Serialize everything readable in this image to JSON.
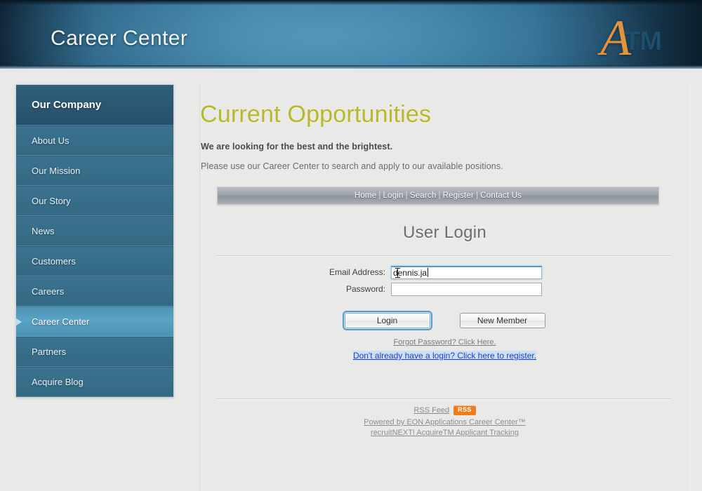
{
  "header": {
    "site_title": "Career Center",
    "logo_a": "A",
    "logo_tm": "TM"
  },
  "sidebar": {
    "heading": "Our Company",
    "items": [
      {
        "label": "About Us",
        "active": false
      },
      {
        "label": "Our Mission",
        "active": false
      },
      {
        "label": "Our Story",
        "active": false
      },
      {
        "label": "News",
        "active": false
      },
      {
        "label": "Customers",
        "active": false
      },
      {
        "label": "Careers",
        "active": false
      },
      {
        "label": "Career Center",
        "active": true
      },
      {
        "label": "Partners",
        "active": false
      },
      {
        "label": "Acquire Blog",
        "active": false
      }
    ]
  },
  "main": {
    "page_title": "Current Opportunities",
    "lead_1": "We are looking for the best and the brightest.",
    "lead_2": "Please use our Career Center to search and apply to our available positions.",
    "nav": {
      "home": "Home",
      "login": "Login",
      "search": "Search",
      "register": "Register",
      "contact": "Contact Us",
      "separator": "|"
    },
    "login": {
      "title": "User Login",
      "email_label": "Email Address:",
      "email_value": "dennis.ja",
      "email_placeholder": "",
      "password_label": "Password:",
      "password_value": "",
      "password_placeholder": "",
      "login_button": "Login",
      "new_member_button": "New Member",
      "forgot_link": "Forgot Password? Click Here.",
      "register_link": "Don't already have a login? Click here to register."
    },
    "footer": {
      "rss_text": "RSS Feed",
      "rss_badge": "RSS",
      "powered_by": "Powered by EON Applications Career Center™",
      "products": "recruitNEXT! AcquireTM Applicant Tracking"
    }
  },
  "colors": {
    "header_blue": "#3a7ea5",
    "sidebar_head": "#2f5f7c",
    "sidebar_item": "#3a7290",
    "sidebar_active": "#5aa3c4",
    "logo_orange": "#e2933c",
    "title_olive": "#b9b928",
    "link_blue": "#1a3fd4",
    "rss_orange": "#f07d1c",
    "page_bg": "#e9e9e7"
  }
}
